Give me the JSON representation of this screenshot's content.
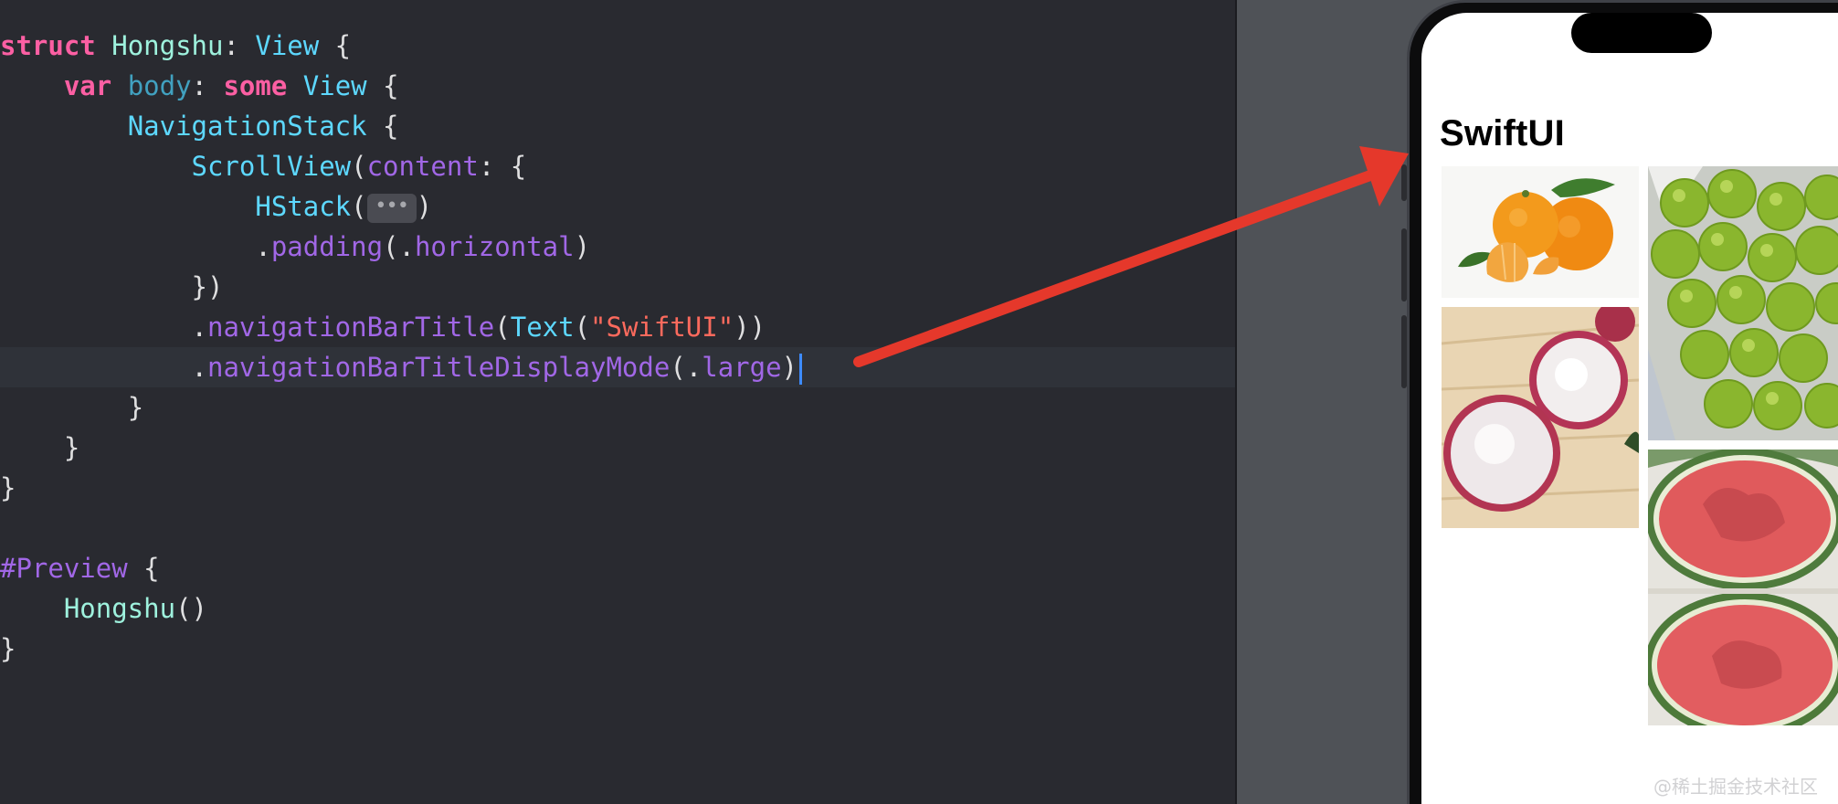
{
  "editor": {
    "lines": [
      {
        "indent": "",
        "tokens": [
          [
            "kw",
            "struct"
          ],
          [
            "plain",
            " "
          ],
          [
            "usertype",
            "Hongshu"
          ],
          [
            "plain",
            ": "
          ],
          [
            "type",
            "View"
          ],
          [
            "plain",
            " {"
          ]
        ]
      },
      {
        "indent": "    ",
        "tokens": [
          [
            "kw",
            "var"
          ],
          [
            "plain",
            " "
          ],
          [
            "prop",
            "body"
          ],
          [
            "plain",
            ": "
          ],
          [
            "kw",
            "some"
          ],
          [
            "plain",
            " "
          ],
          [
            "type",
            "View"
          ],
          [
            "plain",
            " {"
          ]
        ]
      },
      {
        "indent": "        ",
        "tokens": [
          [
            "type",
            "NavigationStack"
          ],
          [
            "plain",
            " {"
          ]
        ]
      },
      {
        "indent": "            ",
        "tokens": [
          [
            "type",
            "ScrollView"
          ],
          [
            "plain",
            "("
          ],
          [
            "fn",
            "content"
          ],
          [
            "plain",
            ": {"
          ]
        ]
      },
      {
        "indent": "                ",
        "tokens": [
          [
            "type",
            "HStack"
          ],
          [
            "plain",
            "("
          ],
          [
            "fold",
            "•••"
          ],
          [
            "plain",
            ")"
          ]
        ]
      },
      {
        "indent": "                ",
        "tokens": [
          [
            "plain",
            "."
          ],
          [
            "fn",
            "padding"
          ],
          [
            "plain",
            "(."
          ],
          [
            "fn",
            "horizontal"
          ],
          [
            "plain",
            ")"
          ]
        ]
      },
      {
        "indent": "            ",
        "tokens": [
          [
            "plain",
            "})"
          ]
        ]
      },
      {
        "indent": "            ",
        "tokens": [
          [
            "plain",
            "."
          ],
          [
            "fn",
            "navigationBarTitle"
          ],
          [
            "plain",
            "("
          ],
          [
            "type",
            "Text"
          ],
          [
            "plain",
            "("
          ],
          [
            "str",
            "\"SwiftUI\""
          ],
          [
            "plain",
            "))"
          ]
        ]
      },
      {
        "indent": "            ",
        "tokens": [
          [
            "plain",
            "."
          ],
          [
            "fn",
            "navigationBarTitleDisplayMode"
          ],
          [
            "plain",
            "(."
          ],
          [
            "fn",
            "large"
          ],
          [
            "plain",
            ")"
          ],
          [
            "caret",
            ""
          ]
        ]
      },
      {
        "indent": "        ",
        "tokens": [
          [
            "plain",
            "}"
          ]
        ]
      },
      {
        "indent": "    ",
        "tokens": [
          [
            "plain",
            "}"
          ]
        ]
      },
      {
        "indent": "",
        "tokens": [
          [
            "plain",
            "}"
          ]
        ]
      },
      {
        "indent": "",
        "tokens": [
          [
            "plain",
            ""
          ]
        ]
      },
      {
        "indent": "",
        "tokens": [
          [
            "macro",
            "#Preview"
          ],
          [
            "plain",
            " {"
          ]
        ]
      },
      {
        "indent": "    ",
        "tokens": [
          [
            "usertype",
            "Hongshu"
          ],
          [
            "plain",
            "()"
          ]
        ]
      },
      {
        "indent": "",
        "tokens": [
          [
            "plain",
            "}"
          ]
        ]
      }
    ]
  },
  "preview": {
    "nav_title": "SwiftUI",
    "photos": [
      "mandarin-oranges",
      "lychees",
      "green-plums",
      "watermelon"
    ]
  },
  "watermark": "@稀土掘金技术社区",
  "colors": {
    "editor_bg": "#292a30",
    "canvas_bg": "#4f5257",
    "arrow": "#e5382b",
    "keyword": "#fc5fa3",
    "type": "#5dd8ff",
    "function": "#a167e6",
    "string": "#fc6a5d"
  }
}
